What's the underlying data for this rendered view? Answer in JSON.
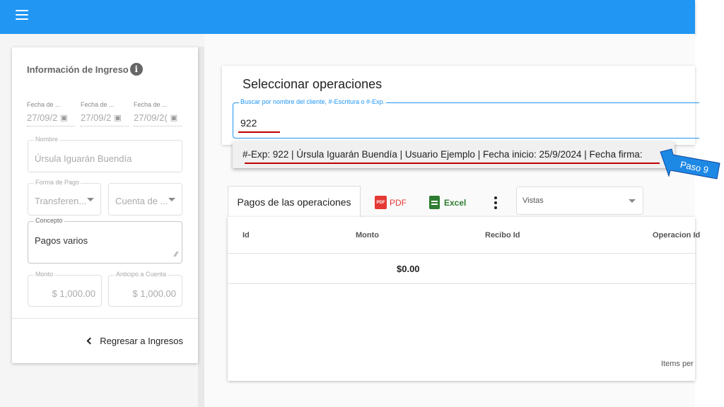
{
  "app_bar": {
    "menu_icon": "menu-icon",
    "color": "#2196f3"
  },
  "income_info": {
    "title": "Información de Ingreso",
    "info_icon": "i",
    "dates": [
      {
        "label": "Fecha de ...",
        "value": "27/09/2"
      },
      {
        "label": "Fecha de ...",
        "value": "27/09/2"
      },
      {
        "label": "Fecha de ...",
        "value": "27/09/2("
      }
    ],
    "nombre": {
      "label": "Nombre",
      "value": "Úrsula  Iguarán  Buendía"
    },
    "forma_pago": {
      "label": "Forma de Pago",
      "value": "Transferen..."
    },
    "cuenta": {
      "value": "Cuenta de ..."
    },
    "concepto": {
      "label": "Concepto",
      "value": "Pagos varios"
    },
    "monto": {
      "label": "Monto",
      "value": "$ 1,000.00"
    },
    "anticipo": {
      "label": "Anticipo a Cuenta",
      "value": "$ 1,000.00"
    },
    "back_label": "Regresar a Ingresos"
  },
  "select_ops": {
    "title": "Seleccionar operaciones",
    "search_label": "Buscar por nombre del cliente, #-Escritura o #-Exp.",
    "search_value": "922",
    "suggestion": "#-Exp: 922 | Úrsula Iguarán Buendía | Usuario Ejemplo | Fecha inicio: 25/9/2024 | Fecha firma:"
  },
  "annotation": {
    "step_label": "Paso 9",
    "arrow_color": "#1e88e5",
    "underline_color": "#c00000"
  },
  "toolbar": {
    "tab_label": "Pagos de las operaciones",
    "pdf_label": "PDF",
    "pdf_icon_text": "PDF",
    "excel_label": "Excel",
    "vistas_label": "Vistas"
  },
  "table": {
    "headers": [
      "Id",
      "Monto",
      "Recibo Id",
      "Operacion Id"
    ],
    "total": "$0.00",
    "items_per_page_label": "Items per"
  }
}
